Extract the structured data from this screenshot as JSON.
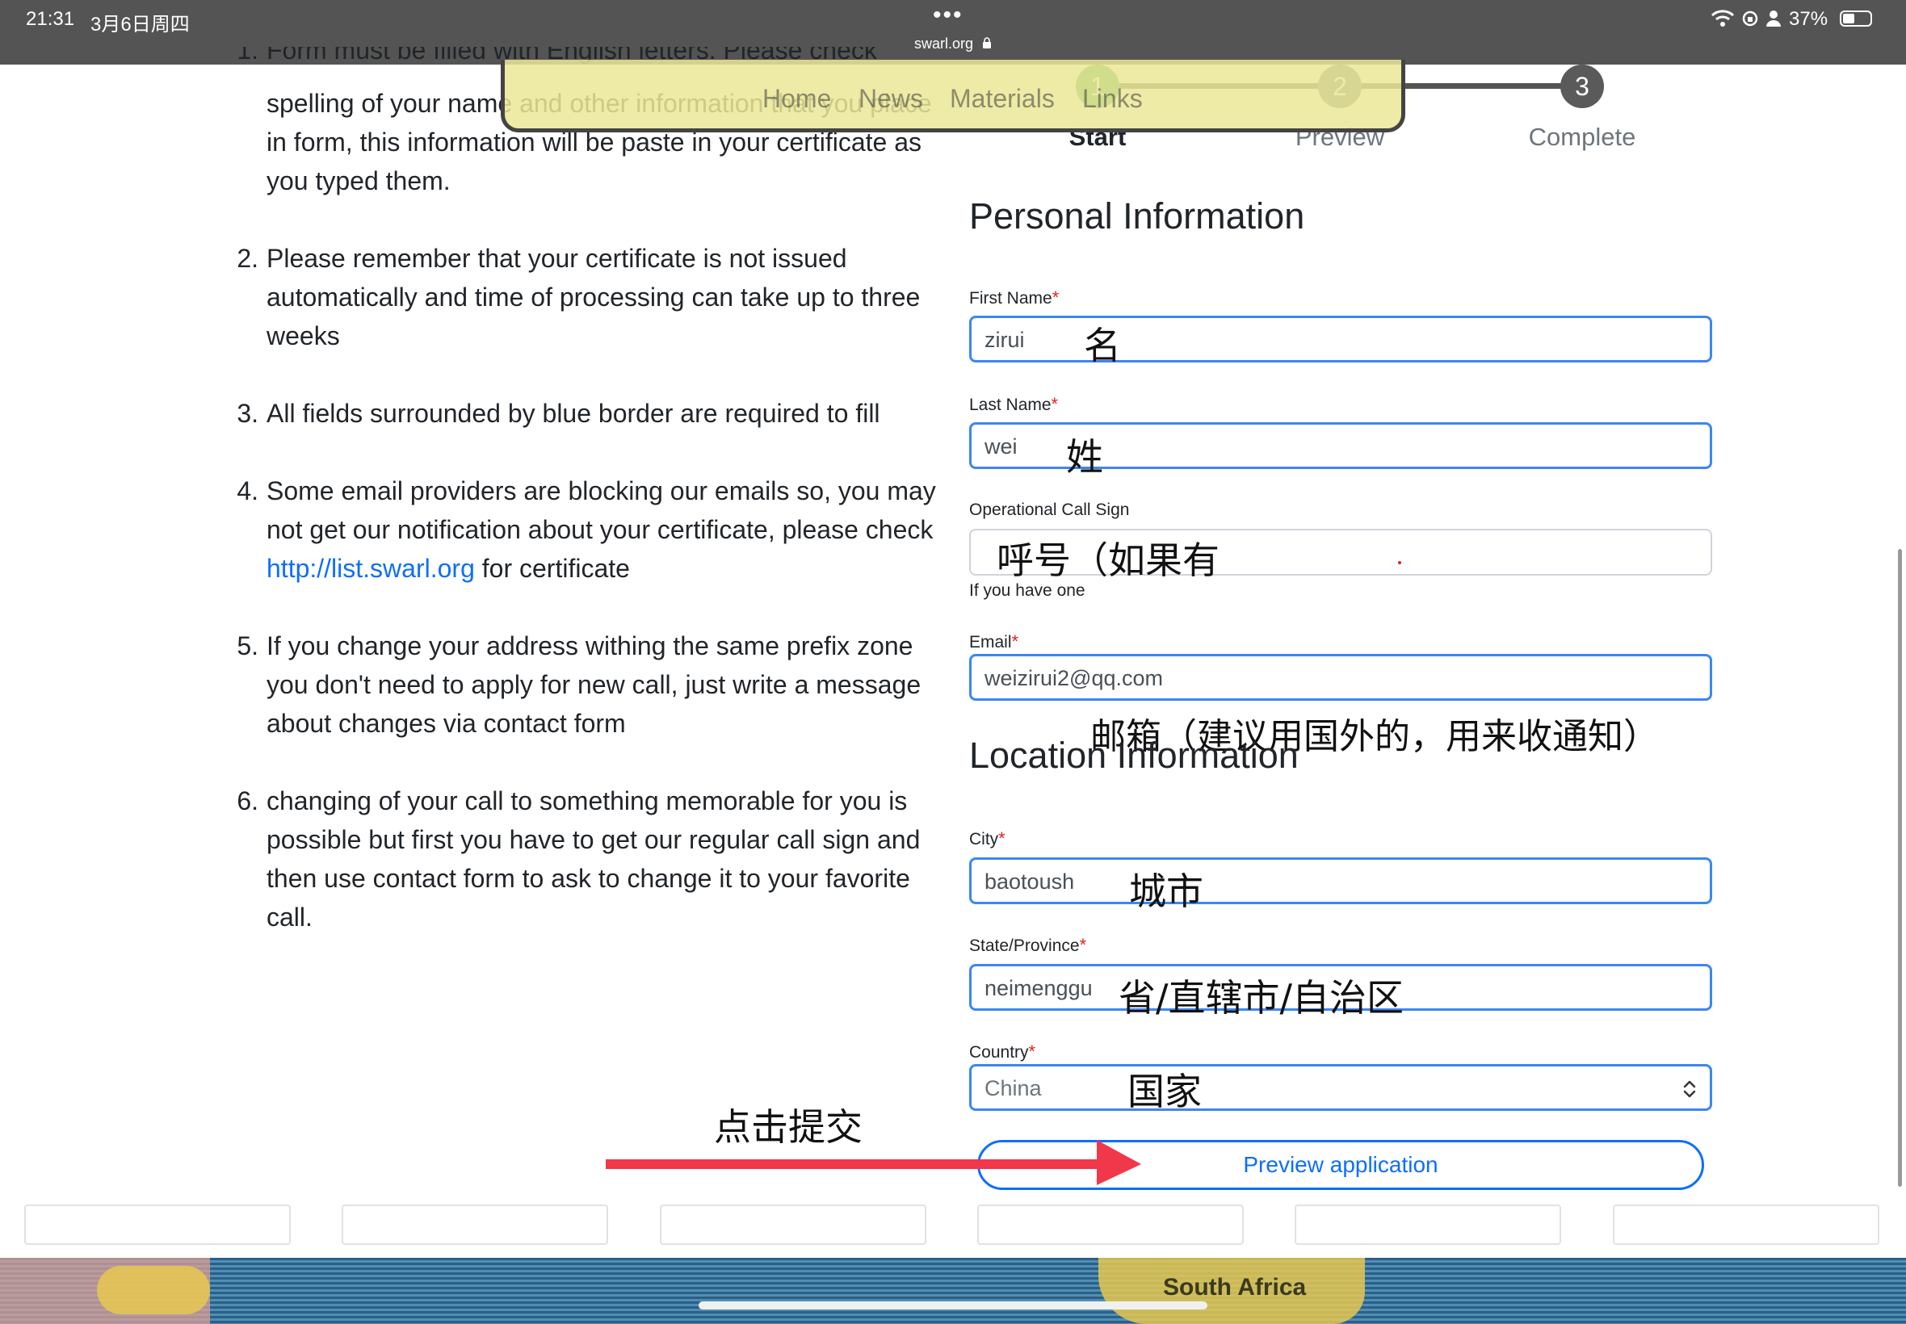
{
  "status_bar": {
    "time": "21:31",
    "date": "3月6日周四",
    "url": "swarl.org",
    "battery": "37%",
    "dots": "•••"
  },
  "instructions": {
    "partial_top_line": "Form must be filled with English letters. Please check",
    "items": [
      {
        "num": "1.",
        "text": "spelling of your name and other information that you place in form, this information will be paste in your certificate as you typed them."
      },
      {
        "num": "2.",
        "text": "Please remember that your certificate is not issued automatically and time of processing can take up to three weeks"
      },
      {
        "num": "3.",
        "text": "All fields surrounded by blue border are required to fill"
      },
      {
        "num": "4.",
        "text_before": "Some email providers are blocking our emails so, you may not get our notification about your certificate, please check ",
        "link": "http://list.swarl.org",
        "text_after": " for certificate"
      },
      {
        "num": "5.",
        "text": "If you change your address withing the same prefix zone you don't need to apply for new call, just write a message about changes via contact form"
      },
      {
        "num": "6.",
        "text": "changing of your call to something memorable for you is possible but first you have to get our regular call sign and then use contact form to ask to change it to your favorite call."
      }
    ]
  },
  "nav_overlay": {
    "items": [
      "Home",
      "News",
      "Materials",
      "Links"
    ]
  },
  "stepper": {
    "steps": [
      {
        "num": "1",
        "label": "Start"
      },
      {
        "num": "2",
        "label": "Preview"
      },
      {
        "num": "3",
        "label": "Complete"
      }
    ]
  },
  "form": {
    "personal_heading": "Personal Information",
    "location_heading": "Location Information",
    "required_mark": "*",
    "first_name": {
      "label": "First Name",
      "value": "zirui"
    },
    "last_name": {
      "label": "Last Name",
      "value": "wei"
    },
    "call_sign": {
      "label": "Operational Call Sign",
      "value": "",
      "help": "If you have one"
    },
    "email": {
      "label": "Email",
      "value": "weizirui2@qq.com"
    },
    "city": {
      "label": "City",
      "value": "baotoush"
    },
    "state": {
      "label": "State/Province",
      "value": "neimenggu"
    },
    "country": {
      "label": "Country",
      "value": "China"
    },
    "submit_label": "Preview application"
  },
  "annotations": {
    "first_name": "名",
    "last_name": "姓",
    "call_sign": "呼号（如果有",
    "email": "邮箱（建议用国外的，用来收通知）",
    "city": "城市",
    "state": "省/直辖市/自治区",
    "country": "国家",
    "submit": "点击提交"
  },
  "map_label": "South Africa",
  "colors": {
    "required": "#e02020",
    "input_border": "#3b87f0",
    "link": "#0d6efd",
    "arrow": "#f0384a",
    "status_bar": "#545454"
  }
}
